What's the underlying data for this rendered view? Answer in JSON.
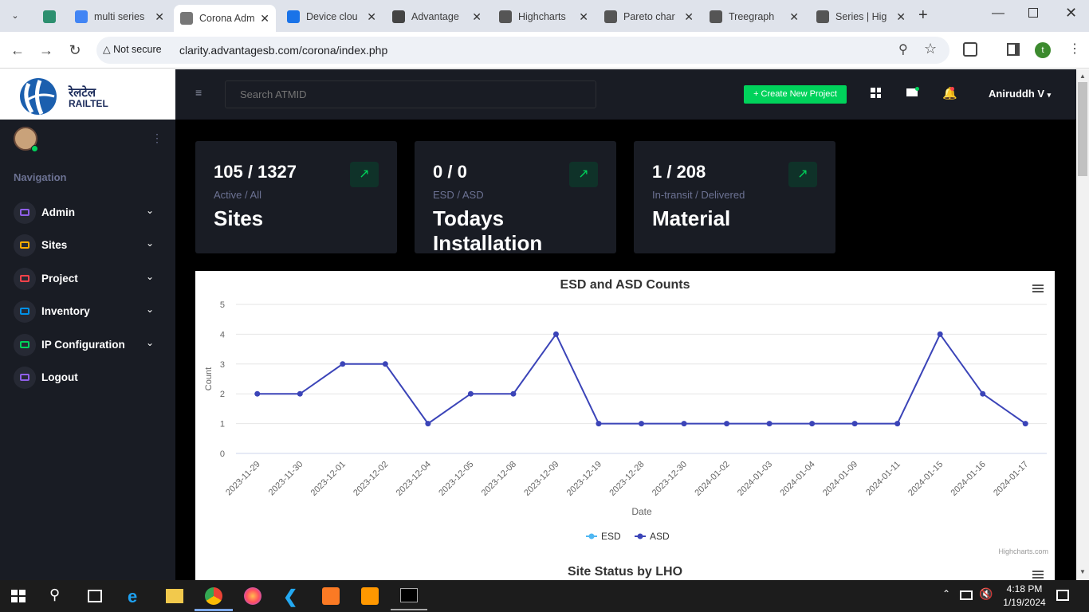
{
  "browser": {
    "tabs": [
      {
        "title": "",
        "x": 46,
        "w": 34,
        "fav": "#2d8f6f",
        "active": false
      },
      {
        "title": "multi series",
        "x": 86,
        "w": 128,
        "fav": "#4285f4",
        "active": false
      },
      {
        "title": "Corona Adm",
        "x": 218,
        "w": 128,
        "fav": "#777",
        "active": true
      },
      {
        "title": "Device clou",
        "x": 352,
        "w": 128,
        "fav": "#1a73e8",
        "active": false
      },
      {
        "title": "Advantage",
        "x": 484,
        "w": 128,
        "fav": "#444",
        "active": false
      },
      {
        "title": "Highcharts",
        "x": 618,
        "w": 128,
        "fav": "#555",
        "active": false
      },
      {
        "title": "Pareto char",
        "x": 750,
        "w": 128,
        "fav": "#555",
        "active": false
      },
      {
        "title": "Treegraph",
        "x": 882,
        "w": 128,
        "fav": "#555",
        "active": false
      },
      {
        "title": "Series | Hig",
        "x": 1016,
        "w": 128,
        "fav": "#555",
        "active": false
      }
    ],
    "not_secure": "Not secure",
    "url": "clarity.advantagesb.com/corona/index.php",
    "profile_initial": "t"
  },
  "app": {
    "logo_text": "रेलटेल",
    "logo_sub": "RAILTEL",
    "search_placeholder": "Search ATMID",
    "create_button": "+ Create New Project",
    "user_name": "Aniruddh V",
    "nav_heading": "Navigation",
    "nav": [
      {
        "label": "Admin",
        "color": "#8f5fe8",
        "chev": true
      },
      {
        "label": "Sites",
        "color": "#ffab00",
        "chev": true
      },
      {
        "label": "Project",
        "color": "#fc424a",
        "chev": true
      },
      {
        "label": "Inventory",
        "color": "#0090e7",
        "chev": true
      },
      {
        "label": "IP Configuration",
        "color": "#00d25b",
        "chev": true
      },
      {
        "label": "Logout",
        "color": "#8f5fe8",
        "chev": false
      }
    ],
    "cards": [
      {
        "num": "105 / 1327",
        "sub": "Active / All",
        "big": "Sites"
      },
      {
        "num": "0 / 0",
        "sub": "ESD / ASD",
        "big": "Todays Installation"
      },
      {
        "num": "1 / 208",
        "sub": "In-transit / Delivered",
        "big": "Material"
      }
    ],
    "second_chart_title": "Site Status by LHO",
    "credits": "Highcharts.com"
  },
  "chart_data": {
    "type": "line",
    "title": "ESD and ASD Counts",
    "xlabel": "Date",
    "ylabel": "Count",
    "ylim": [
      0,
      5
    ],
    "yticks": [
      0,
      1,
      2,
      3,
      4,
      5
    ],
    "categories": [
      "2023-11-29",
      "2023-11-30",
      "2023-12-01",
      "2023-12-02",
      "2023-12-04",
      "2023-12-05",
      "2023-12-08",
      "2023-12-09",
      "2023-12-19",
      "2023-12-28",
      "2023-12-30",
      "2024-01-02",
      "2024-01-03",
      "2024-01-04",
      "2024-01-09",
      "2024-01-11",
      "2024-01-15",
      "2024-01-16",
      "2024-01-17"
    ],
    "series": [
      {
        "name": "ESD",
        "color": "#4fb7f2",
        "values": []
      },
      {
        "name": "ASD",
        "color": "#3b44b8",
        "values": [
          2,
          2,
          3,
          3,
          1,
          2,
          2,
          4,
          1,
          1,
          1,
          1,
          1,
          1,
          1,
          1,
          4,
          2,
          1
        ]
      }
    ],
    "legend": "bottom-center",
    "grid": true
  },
  "taskbar": {
    "time": "4:18 PM",
    "date": "1/19/2024"
  }
}
